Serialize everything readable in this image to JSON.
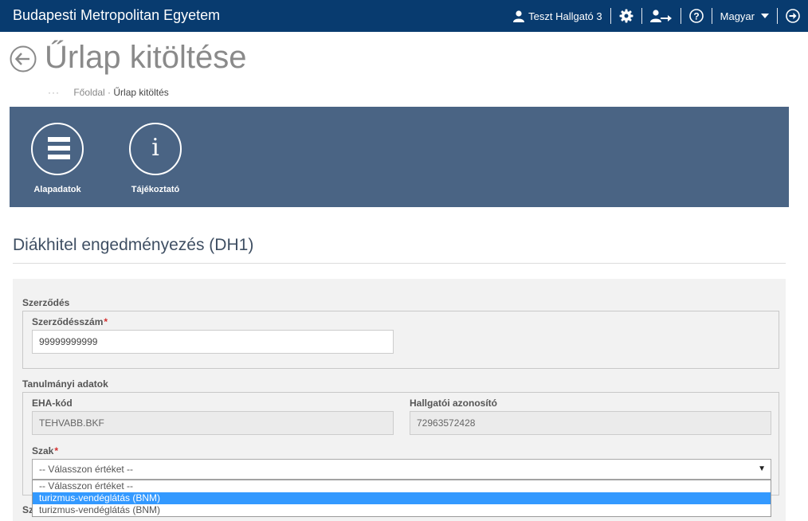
{
  "header": {
    "brand": "Budapesti Metropolitan Egyetem",
    "user_name": "Teszt Hallgató 3",
    "language": "Magyar",
    "icons": [
      "user-icon",
      "gear-icon",
      "role-switch-icon",
      "help-icon",
      "logout-icon"
    ]
  },
  "page": {
    "title": "Űrlap kitöltése",
    "breadcrumb": {
      "dots": "···",
      "home": "Főoldal",
      "separator": "·",
      "current": "Űrlap kitöltés"
    }
  },
  "panel": {
    "color": "#4a6484",
    "tiles": [
      {
        "label": "Alapadatok",
        "icon": "list-icon"
      },
      {
        "label": "Tájékoztató",
        "icon": "info-icon"
      }
    ]
  },
  "form": {
    "title": "Diákhitel engedményezés (DH1)",
    "sections": {
      "contract": {
        "label": "Szerződés",
        "contract_number": {
          "label": "Szerződésszám",
          "required_mark": "*",
          "value": "99999999999"
        }
      },
      "study": {
        "label": "Tanulmányi adatok",
        "eha": {
          "label": "EHA-kód",
          "value": "TEHVABB.BKF"
        },
        "student_id": {
          "label": "Hallgatói azonosító",
          "value": "72963572428"
        },
        "major": {
          "label": "Szak",
          "required_mark": "*",
          "selected": "-- Válasszon értéket --",
          "arrow": "▼",
          "options": [
            "-- Válasszon értéket --",
            "turizmus-vendéglátás (BNM)",
            "turizmus-vendéglátás (BNM)"
          ],
          "highlighted_index": 1
        }
      },
      "next_label_fragment": "Sz"
    }
  },
  "colors": {
    "topbar": "#083b6f",
    "highlight": "#3399ff",
    "required": "#d32f2f"
  }
}
